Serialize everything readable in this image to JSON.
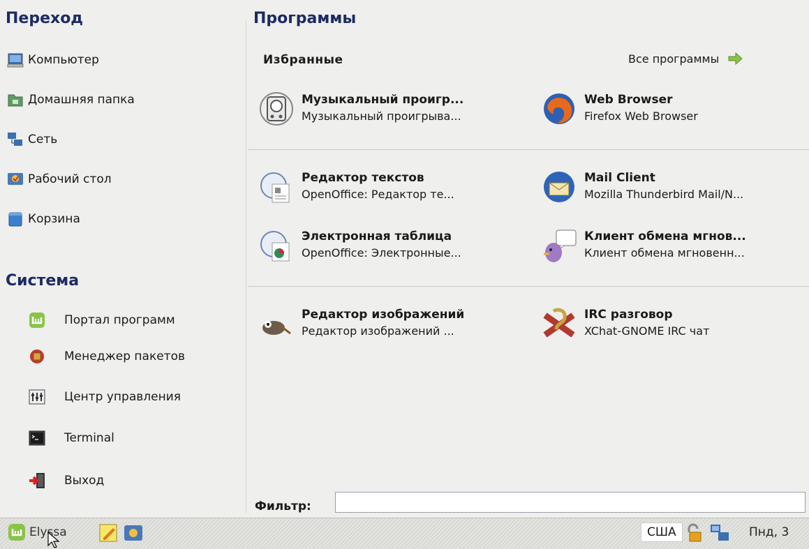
{
  "left": {
    "places_title": "Переход",
    "places": [
      {
        "label": "Компьютер",
        "icon": "computer-icon"
      },
      {
        "label": "Домашняя папка",
        "icon": "home-folder-icon"
      },
      {
        "label": "Сеть",
        "icon": "network-icon"
      },
      {
        "label": "Рабочий стол",
        "icon": "desktop-icon"
      },
      {
        "label": "Корзина",
        "icon": "trash-icon"
      }
    ],
    "system_title": "Система",
    "system": [
      {
        "label": "Портал программ",
        "icon": "mint-software-icon"
      },
      {
        "label": "Менеджер пакетов",
        "icon": "package-manager-icon"
      },
      {
        "label": "Центр управления",
        "icon": "control-center-icon"
      },
      {
        "label": "Terminal",
        "icon": "terminal-icon"
      },
      {
        "label": "Выход",
        "icon": "logout-icon"
      }
    ]
  },
  "right": {
    "title": "Программы",
    "favorites_title": "Избранные",
    "all_programs": "Все программы",
    "apps": [
      {
        "name": "Музыкальный проигр...",
        "desc": "Музыкальный проигрыва...",
        "icon": "music-player-icon"
      },
      {
        "name": "Web Browser",
        "desc": "Firefox Web Browser",
        "icon": "firefox-icon"
      },
      {
        "name": "Редактор текстов",
        "desc": "OpenOffice: Редактор те...",
        "icon": "writer-icon"
      },
      {
        "name": "Mail Client",
        "desc": "Mozilla Thunderbird Mail/N...",
        "icon": "thunderbird-icon"
      },
      {
        "name": "Электронная таблица",
        "desc": "OpenOffice: Электронные...",
        "icon": "calc-icon"
      },
      {
        "name": "Клиент обмена мгнов...",
        "desc": "Клиент обмена мгновенн...",
        "icon": "pidgin-icon"
      },
      {
        "name": "Редактор изображений",
        "desc": "Редактор изображений ...",
        "icon": "gimp-icon"
      },
      {
        "name": "IRC разговор",
        "desc": "XChat-GNOME IRC чат",
        "icon": "xchat-icon"
      }
    ],
    "filter_label": "Фильтр:",
    "filter_value": ""
  },
  "taskbar": {
    "menu_label": "Elyssa",
    "keyboard_layout": "США",
    "clock": "Пнд, 3"
  },
  "colors": {
    "heading": "#1d2b63",
    "background": "#efefed"
  }
}
